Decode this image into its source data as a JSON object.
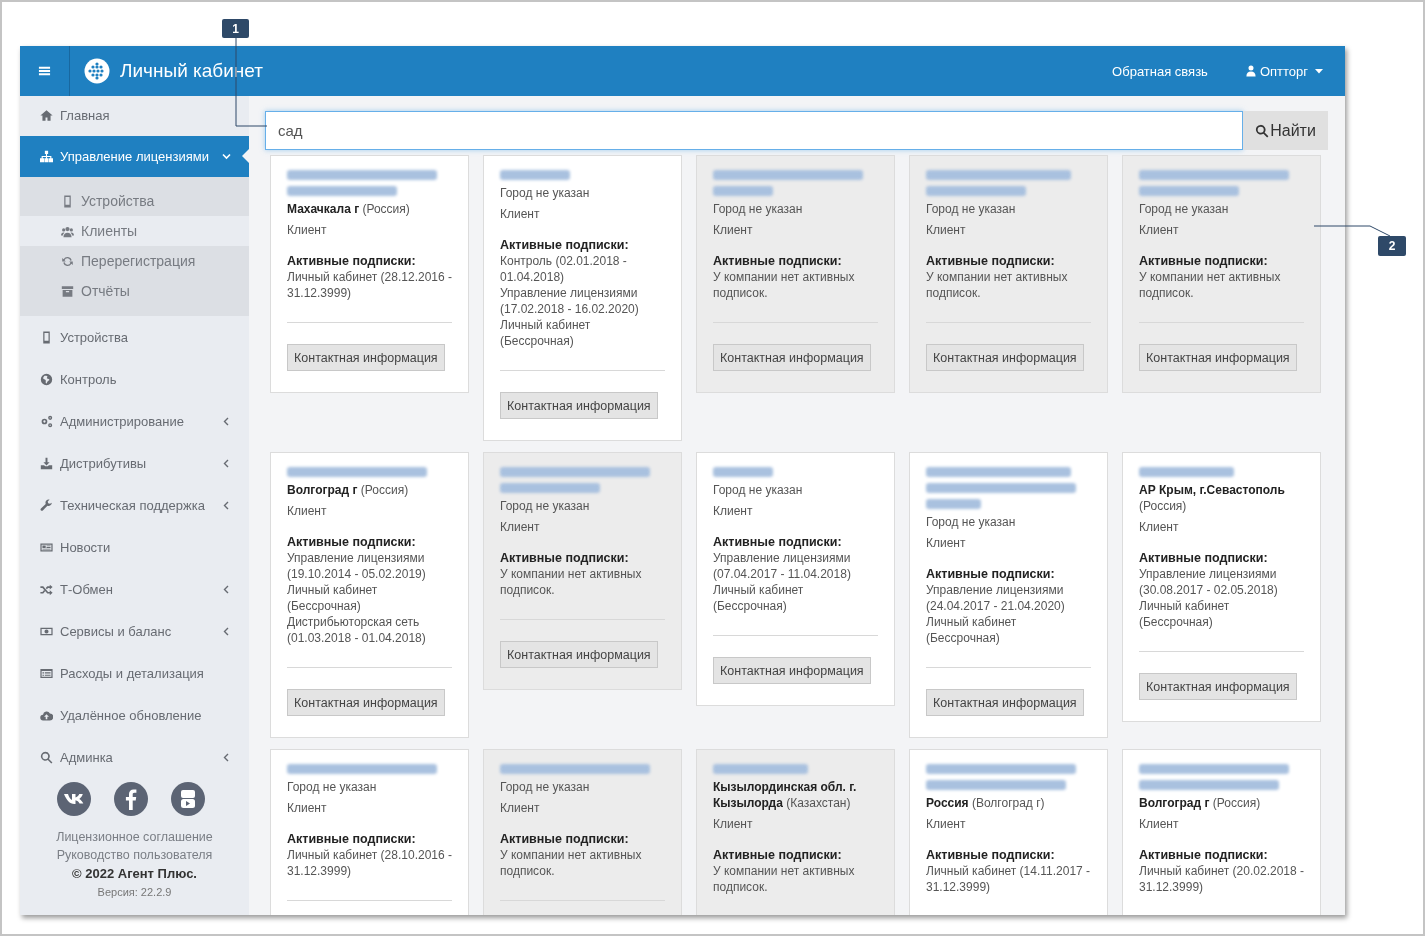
{
  "header": {
    "title": "Личный кабинет",
    "links": [
      {
        "label": "Обратная связь",
        "kind": "link"
      },
      {
        "label": "Оптторг",
        "kind": "user"
      }
    ]
  },
  "sidebar": {
    "items": [
      {
        "label": "Главная",
        "selected": false,
        "collapsible": false,
        "expanded": false
      },
      {
        "label": "Управление лицензиями",
        "selected": true,
        "collapsible": true,
        "expanded": true,
        "children": [
          {
            "label": "Устройства",
            "selected": false
          },
          {
            "label": "Клиенты",
            "selected": true
          },
          {
            "label": "Перерегистрация",
            "selected": false
          },
          {
            "label": "Отчёты",
            "selected": false
          }
        ]
      },
      {
        "label": "Устройства",
        "selected": false,
        "collapsible": false,
        "expanded": false
      },
      {
        "label": "Контроль",
        "selected": false,
        "collapsible": false,
        "expanded": false
      },
      {
        "label": "Администрирование",
        "selected": false,
        "collapsible": true,
        "expanded": false
      },
      {
        "label": "Дистрибутивы",
        "selected": false,
        "collapsible": true,
        "expanded": false
      },
      {
        "label": "Техническая поддержка",
        "selected": false,
        "collapsible": true,
        "expanded": false
      },
      {
        "label": "Новости",
        "selected": false,
        "collapsible": false,
        "expanded": false
      },
      {
        "label": "Т-Обмен",
        "selected": false,
        "collapsible": true,
        "expanded": false
      },
      {
        "label": "Сервисы и баланс",
        "selected": false,
        "collapsible": true,
        "expanded": false
      },
      {
        "label": "Расходы и детализация",
        "selected": false,
        "collapsible": false,
        "expanded": false
      },
      {
        "label": "Удалённое обновление",
        "selected": false,
        "collapsible": false,
        "expanded": false
      },
      {
        "label": "Админка",
        "selected": false,
        "collapsible": true,
        "expanded": false
      }
    ],
    "footer": {
      "links": [
        "Лицензионное соглашение",
        "Руководство пользователя"
      ],
      "copyright": "© 2022 Агент Плюс.",
      "version": "Версия: 22.2.9"
    }
  },
  "search": {
    "value": "сад",
    "button": "Найти"
  },
  "cards": [
    {
      "dimmed": false,
      "name_redacted": true,
      "location": "**Махачкала г** (Россия)",
      "role": "Клиент",
      "subscriptions_heading": "Активные подписки:",
      "subscriptions": [
        "Личный кабинет (28.12.2016 - 31.12.3999)"
      ],
      "button": "Контактная информация"
    },
    {
      "dimmed": false,
      "name_redacted": true,
      "location": "Город не указан",
      "role": "Клиент",
      "subscriptions_heading": "Активные подписки:",
      "subscriptions": [
        "Контроль (02.01.2018 - 01.04.2018)",
        "Управление лицензиями (17.02.2018 - 16.02.2020)",
        "Личный кабинет (Бессрочная)"
      ],
      "button": "Контактная информация"
    },
    {
      "dimmed": true,
      "name_redacted": true,
      "location": "Город не указан",
      "role": "Клиент",
      "subscriptions_heading": "Активные подписки:",
      "subscriptions": [
        "У компании нет активных подписок."
      ],
      "button": "Контактная информация"
    },
    {
      "dimmed": true,
      "name_redacted": true,
      "location": "Город не указан",
      "role": "Клиент",
      "subscriptions_heading": "Активные подписки:",
      "subscriptions": [
        "У компании нет активных подписок."
      ],
      "button": "Контактная информация"
    },
    {
      "dimmed": true,
      "name_redacted": true,
      "location": "Город не указан",
      "role": "Клиент",
      "subscriptions_heading": "Активные подписки:",
      "subscriptions": [
        "У компании нет активных подписок."
      ],
      "button": "Контактная информация"
    },
    {
      "dimmed": false,
      "name_redacted": true,
      "location": "**Волгоград г** (Россия)",
      "role": "Клиент",
      "subscriptions_heading": "Активные подписки:",
      "subscriptions": [
        "Управление лицензиями (19.10.2014 - 05.02.2019)",
        "Личный кабинет (Бессрочная)",
        "Дистрибьюторская сеть (01.03.2018 - 01.04.2018)"
      ],
      "button": "Контактная информация"
    },
    {
      "dimmed": true,
      "name_redacted": true,
      "location": "Город не указан",
      "role": "Клиент",
      "subscriptions_heading": "Активные подписки:",
      "subscriptions": [
        "У компании нет активных подписок."
      ],
      "button": "Контактная информация"
    },
    {
      "dimmed": false,
      "name_redacted": true,
      "location": "Город не указан",
      "role": "Клиент",
      "subscriptions_heading": "Активные подписки:",
      "subscriptions": [
        "Управление лицензиями (07.04.2017 - 11.04.2018)",
        "Личный кабинет (Бессрочная)"
      ],
      "button": "Контактная информация"
    },
    {
      "dimmed": false,
      "name_redacted": true,
      "location": "Город не указан",
      "role": "Клиент",
      "subscriptions_heading": "Активные подписки:",
      "subscriptions": [
        "Управление лицензиями (24.04.2017 - 21.04.2020)",
        "Личный кабинет (Бессрочная)"
      ],
      "button": "Контактная информация"
    },
    {
      "dimmed": false,
      "name_redacted": true,
      "location": "**АР Крым, г.Севастополь** (Россия)",
      "role": "Клиент",
      "subscriptions_heading": "Активные подписки:",
      "subscriptions": [
        "Управление лицензиями (30.08.2017 - 02.05.2018)",
        "Личный кабинет (Бессрочная)"
      ],
      "button": "Контактная информация"
    },
    {
      "dimmed": false,
      "name_redacted": true,
      "location": "Город не указан",
      "role": "Клиент",
      "subscriptions_heading": "Активные подписки:",
      "subscriptions": [
        "Личный кабинет (28.10.2016 - 31.12.3999)"
      ]
    },
    {
      "dimmed": true,
      "name_redacted": true,
      "location": "Город не указан",
      "role": "Клиент",
      "subscriptions_heading": "Активные подписки:",
      "subscriptions": [
        "У компании нет активных подписок."
      ]
    },
    {
      "dimmed": true,
      "name_redacted": true,
      "location": "**Кызылординская обл. г. Кызылорда** (Казахстан)",
      "role": "Клиент",
      "subscriptions_heading": "Активные подписки:",
      "subscriptions": [
        "У компании нет активных подписок."
      ]
    },
    {
      "dimmed": false,
      "name_redacted": true,
      "location": "**Россия** (Волгоград г)",
      "role": "Клиент",
      "subscriptions_heading": "Активные подписки:",
      "subscriptions": [
        "Личный кабинет (14.11.2017 - 31.12.3999)"
      ]
    },
    {
      "dimmed": false,
      "name_redacted": true,
      "location": "**Волгоград г** (Россия)",
      "role": "Клиент",
      "subscriptions_heading": "Активные подписки:",
      "subscriptions": [
        "Личный кабинет (20.02.2018 - 31.12.3999)"
      ]
    }
  ],
  "callouts": [
    {
      "label": "1"
    },
    {
      "label": "2"
    }
  ]
}
